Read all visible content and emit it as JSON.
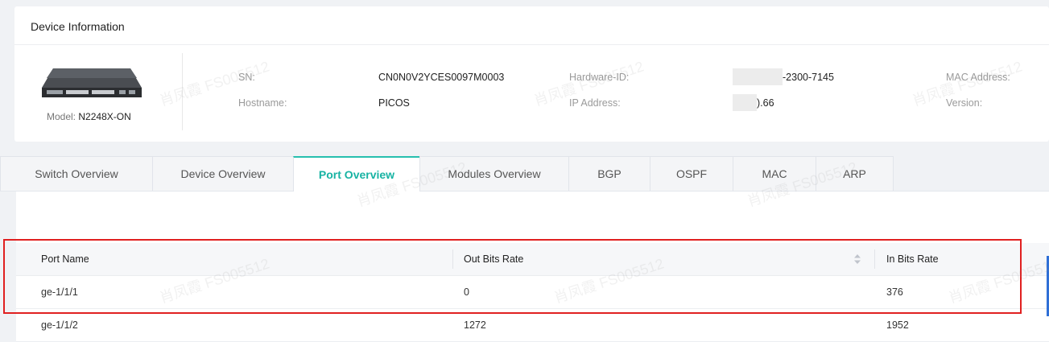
{
  "device_info": {
    "title": "Device Information",
    "model_label": "Model:",
    "model_value": "N2248X-ON",
    "fields": {
      "sn_label": "SN:",
      "sn_value": "CN0N0V2YCES0097M0003",
      "hostname_label": "Hostname:",
      "hostname_value": "PICOS",
      "hardware_id_label": "Hardware-ID:",
      "hardware_id_value": "-2300-7145",
      "ip_label": "IP Address:",
      "ip_value": ").66",
      "mac_label": "MAC Address:",
      "version_label": "Version:"
    }
  },
  "tabs": [
    {
      "label": "Switch Overview"
    },
    {
      "label": "Device Overview"
    },
    {
      "label": "Port Overview",
      "active": true
    },
    {
      "label": "Modules Overview"
    },
    {
      "label": "BGP"
    },
    {
      "label": "OSPF"
    },
    {
      "label": "MAC"
    },
    {
      "label": "ARP"
    }
  ],
  "table": {
    "columns": [
      "Port Name",
      "Out Bits Rate",
      "In Bits Rate"
    ],
    "rows": [
      [
        "ge-1/1/1",
        "0",
        "376"
      ],
      [
        "ge-1/1/2",
        "1272",
        "1952"
      ]
    ]
  },
  "watermark": "肖凤霞 FS005512",
  "colors": {
    "accent": "#17b3a3",
    "highlight_box": "#e02020",
    "page_bg": "#f0f2f5"
  }
}
